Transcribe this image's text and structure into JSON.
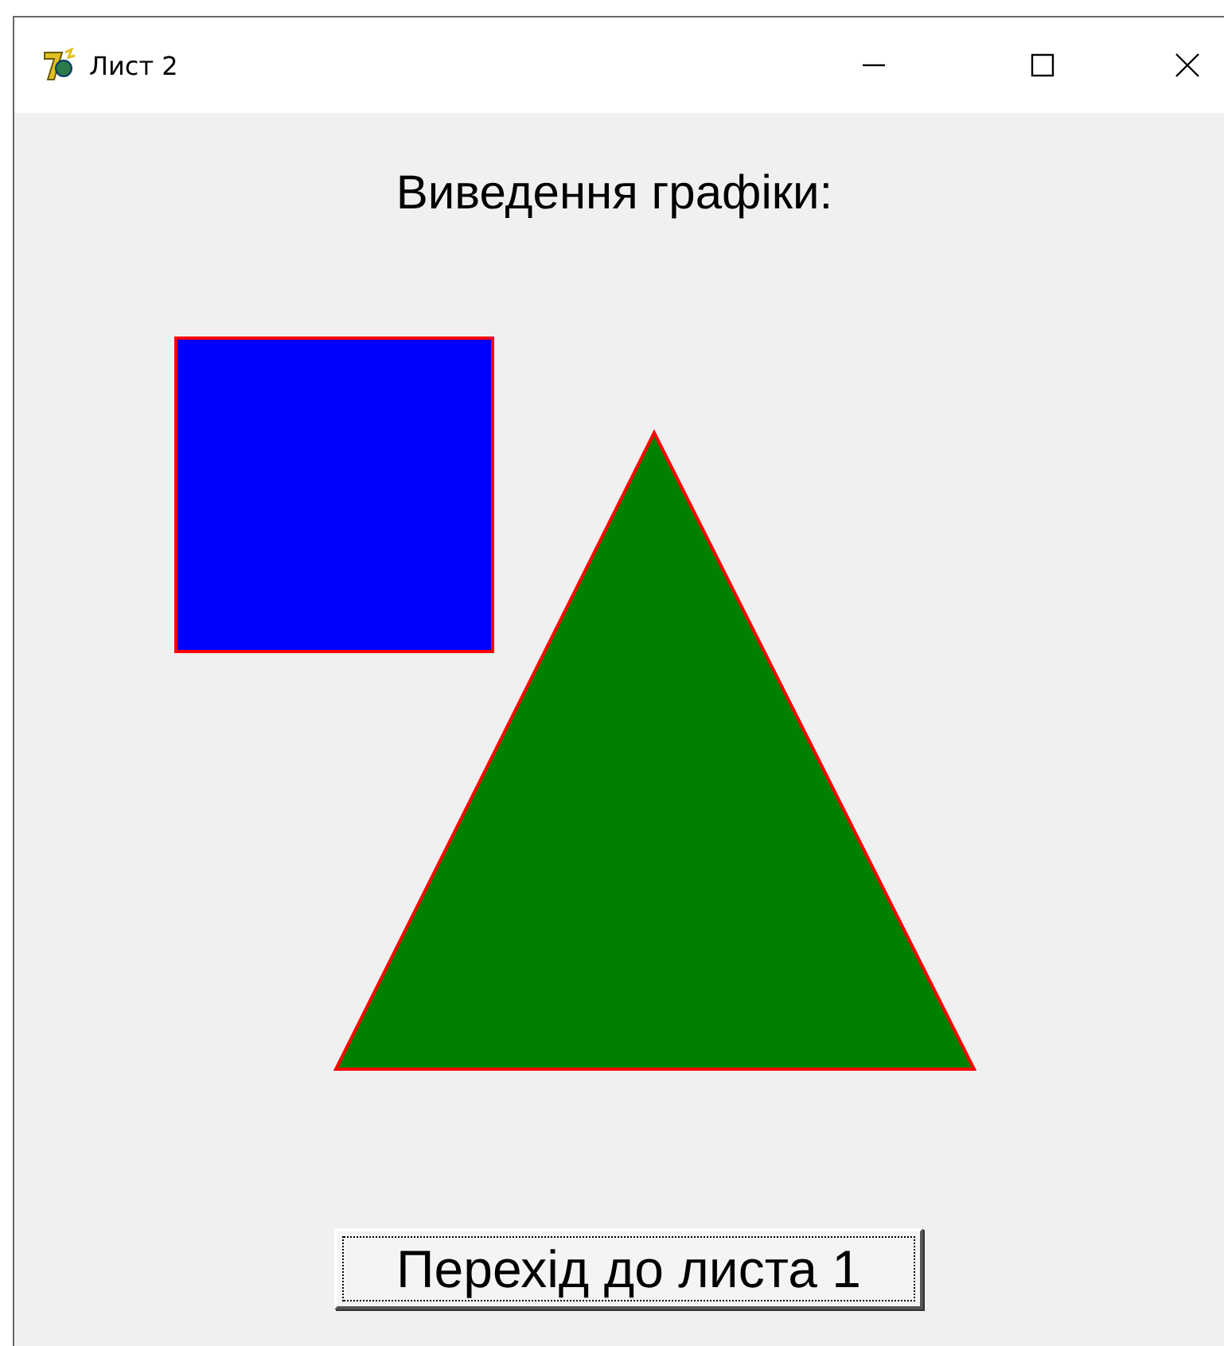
{
  "window": {
    "title": "Лист 2"
  },
  "heading": "Виведення графіки:",
  "shapes": [
    {
      "kind": "square",
      "color": "#0000ff"
    },
    {
      "kind": "triangle",
      "color": "#008000"
    }
  ],
  "button": {
    "label": "Перехід до листа 1",
    "focused": true
  }
}
